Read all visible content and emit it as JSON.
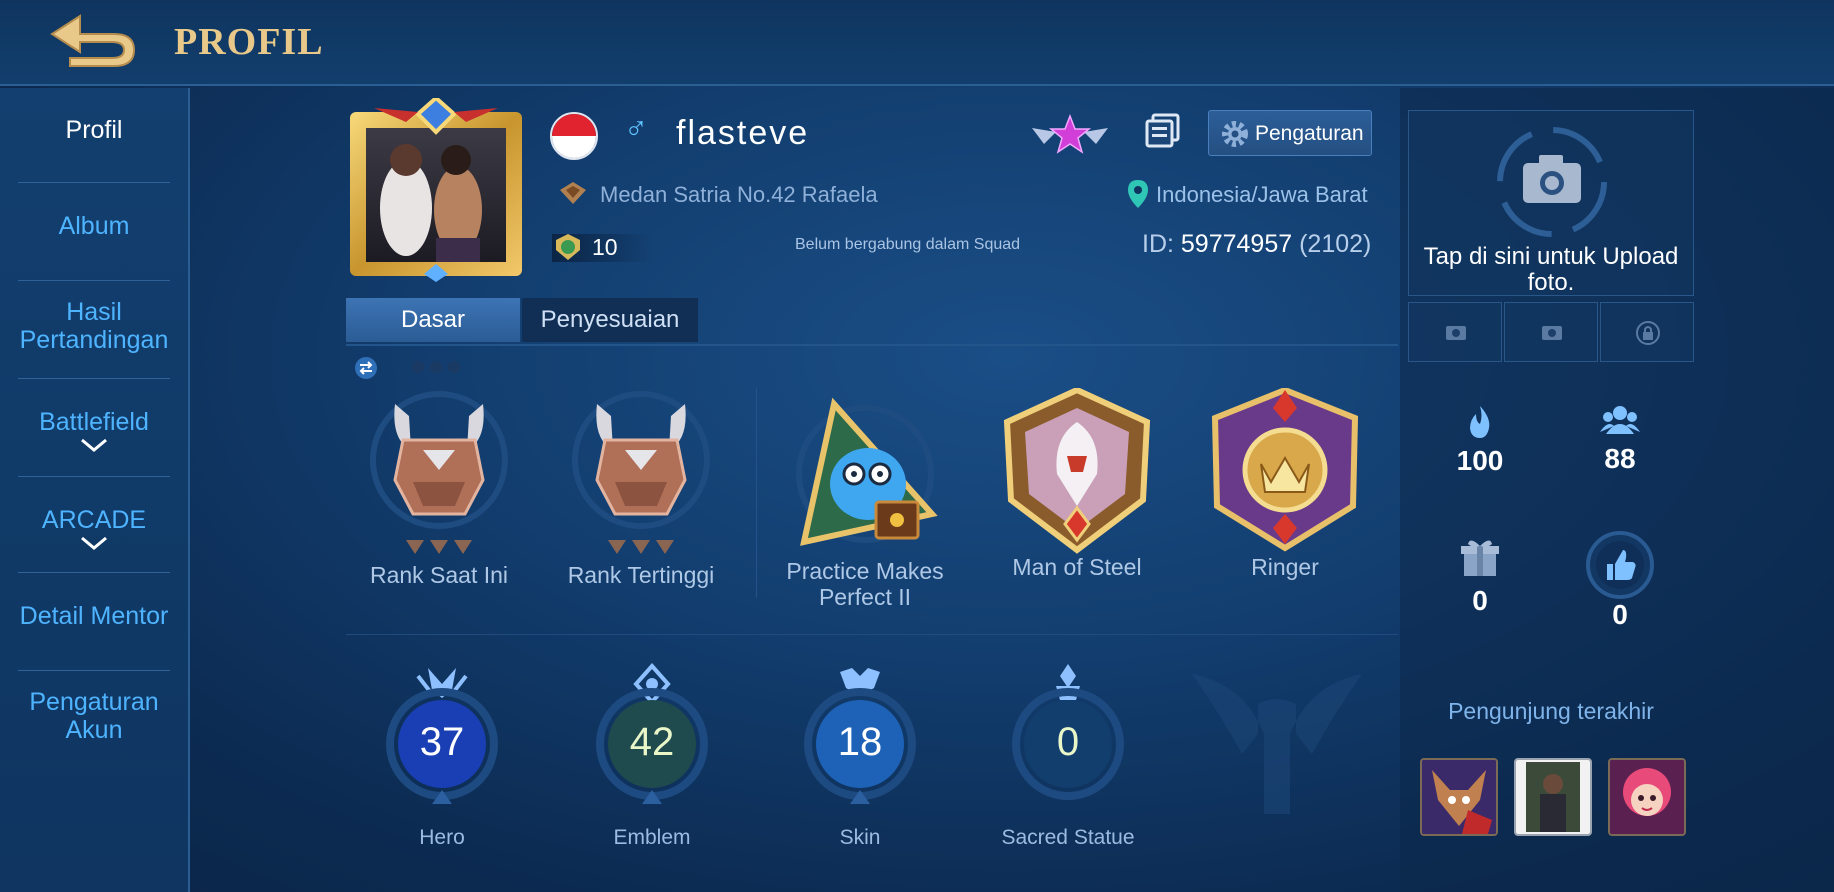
{
  "header": {
    "title": "PROFIL",
    "back_icon": "back-arrow-icon"
  },
  "sidebar": {
    "items": [
      {
        "label": "Profil",
        "active": true
      },
      {
        "label": "Album"
      },
      {
        "label": "Hasil Pertandingan"
      },
      {
        "label": "Battlefield",
        "expandable": true
      },
      {
        "label": "ARCADE",
        "expandable": true
      },
      {
        "label": "Detail Mentor"
      },
      {
        "label": "Pengaturan Akun"
      }
    ]
  },
  "profile": {
    "username": "flasteve",
    "gender_symbol": "♂",
    "squad": "Medan Satria No.42 Rafaela",
    "level": "10",
    "squad_status": "Belum bergabung dalam Squad",
    "location": "Indonesia/Jawa Barat",
    "id_label": "ID:",
    "id_value": "59774957",
    "server": "(2102)",
    "settings_label": "Pengaturan"
  },
  "tabs": [
    {
      "label": "Dasar",
      "active": true
    },
    {
      "label": "Penyesuaian"
    }
  ],
  "achievements": [
    {
      "label": "Rank Saat Ini"
    },
    {
      "label": "Rank Tertinggi"
    },
    {
      "label": "Practice Makes Perfect II"
    },
    {
      "label": "Man of Steel"
    },
    {
      "label": "Ringer"
    }
  ],
  "stats": [
    {
      "value": "37",
      "label": "Hero"
    },
    {
      "value": "42",
      "label": "Emblem"
    },
    {
      "value": "18",
      "label": "Skin"
    },
    {
      "value": "0",
      "label": "Sacred Statue"
    }
  ],
  "right_panel": {
    "upload_text": "Tap di sini untuk Upload foto.",
    "popularity": "100",
    "friends": "88",
    "gifts": "0",
    "likes": "0",
    "visitors_title": "Pengunjung terakhir"
  },
  "colors": {
    "accent_gold": "#e8c98a",
    "link_blue": "#4fb4ff",
    "bg": "#123d6e"
  }
}
